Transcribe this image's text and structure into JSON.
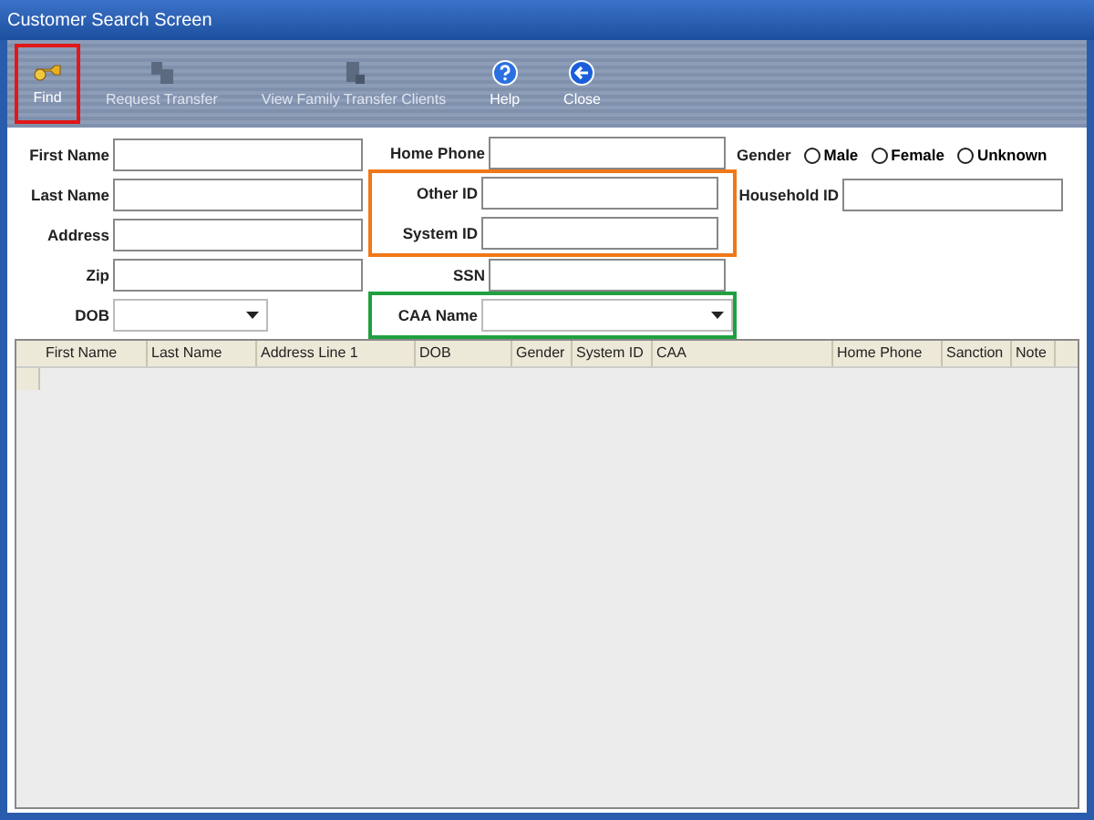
{
  "window": {
    "title": "Customer Search Screen"
  },
  "toolbar": [
    {
      "label": "Find",
      "disabled": false,
      "highlighted": true
    },
    {
      "label": "Request Transfer",
      "disabled": true,
      "highlighted": false
    },
    {
      "label": "View Family Transfer Clients",
      "disabled": true,
      "highlighted": false
    },
    {
      "label": "Help",
      "disabled": false,
      "highlighted": false
    },
    {
      "label": "Close",
      "disabled": false,
      "highlighted": false
    }
  ],
  "form": {
    "columns": [
      [
        {
          "kind": "text",
          "label": "First Name"
        },
        {
          "kind": "text",
          "label": "Last Name"
        },
        {
          "kind": "text",
          "label": "Address"
        },
        {
          "kind": "text",
          "label": "Zip"
        },
        {
          "kind": "combo",
          "label": "DOB"
        }
      ],
      [
        {
          "kind": "text",
          "label": "Home Phone"
        },
        {
          "kind": "group",
          "color": "#f07818",
          "fields": [
            {
              "kind": "text",
              "label": "Other ID"
            },
            {
              "kind": "text",
              "label": "System ID"
            }
          ]
        },
        {
          "kind": "text",
          "label": "SSN"
        },
        {
          "kind": "group",
          "color": "#20a040",
          "fields": [
            {
              "kind": "combo",
              "label": "CAA Name"
            }
          ]
        }
      ],
      [
        {
          "kind": "radio",
          "label": "Gender",
          "options": [
            {
              "label": "Male",
              "selected": false
            },
            {
              "label": "Female",
              "selected": false
            },
            {
              "label": "Unknown",
              "selected": false
            }
          ]
        },
        {
          "kind": "text",
          "label": "Household ID"
        }
      ]
    ]
  },
  "grid": {
    "columns": [
      "First Name",
      "Last Name",
      "Address Line 1",
      "DOB",
      "Gender",
      "System ID",
      "CAA",
      "Home Phone",
      "Sanction",
      "Note"
    ]
  }
}
